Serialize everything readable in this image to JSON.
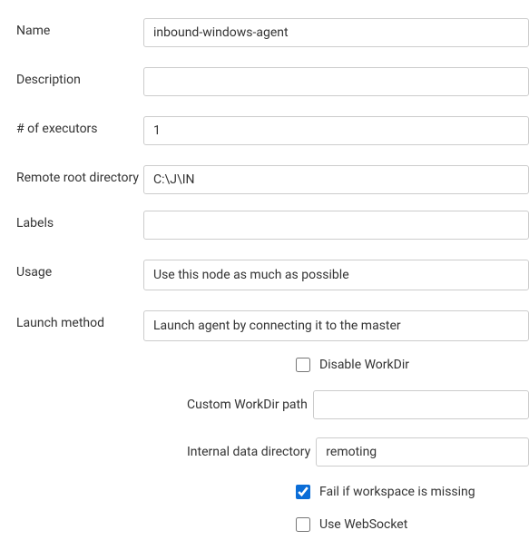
{
  "fields": {
    "name": {
      "label": "Name",
      "value": "inbound-windows-agent"
    },
    "description": {
      "label": "Description",
      "value": ""
    },
    "executors": {
      "label": "# of executors",
      "value": "1"
    },
    "remote_root": {
      "label": "Remote root directory",
      "value": "C:\\J\\IN"
    },
    "labels": {
      "label": "Labels",
      "value": ""
    },
    "usage": {
      "label": "Usage",
      "value": "Use this node as much as possible"
    },
    "launch_method": {
      "label": "Launch method",
      "value": "Launch agent by connecting it to the master"
    }
  },
  "launch_options": {
    "disable_workdir": {
      "label": "Disable WorkDir",
      "checked": false
    },
    "custom_workdir": {
      "label": "Custom WorkDir path",
      "value": ""
    },
    "internal_data_dir": {
      "label": "Internal data directory",
      "value": "remoting"
    },
    "fail_if_missing": {
      "label": "Fail if workspace is missing",
      "checked": true
    },
    "use_websocket": {
      "label": "Use WebSocket",
      "checked": false
    }
  }
}
